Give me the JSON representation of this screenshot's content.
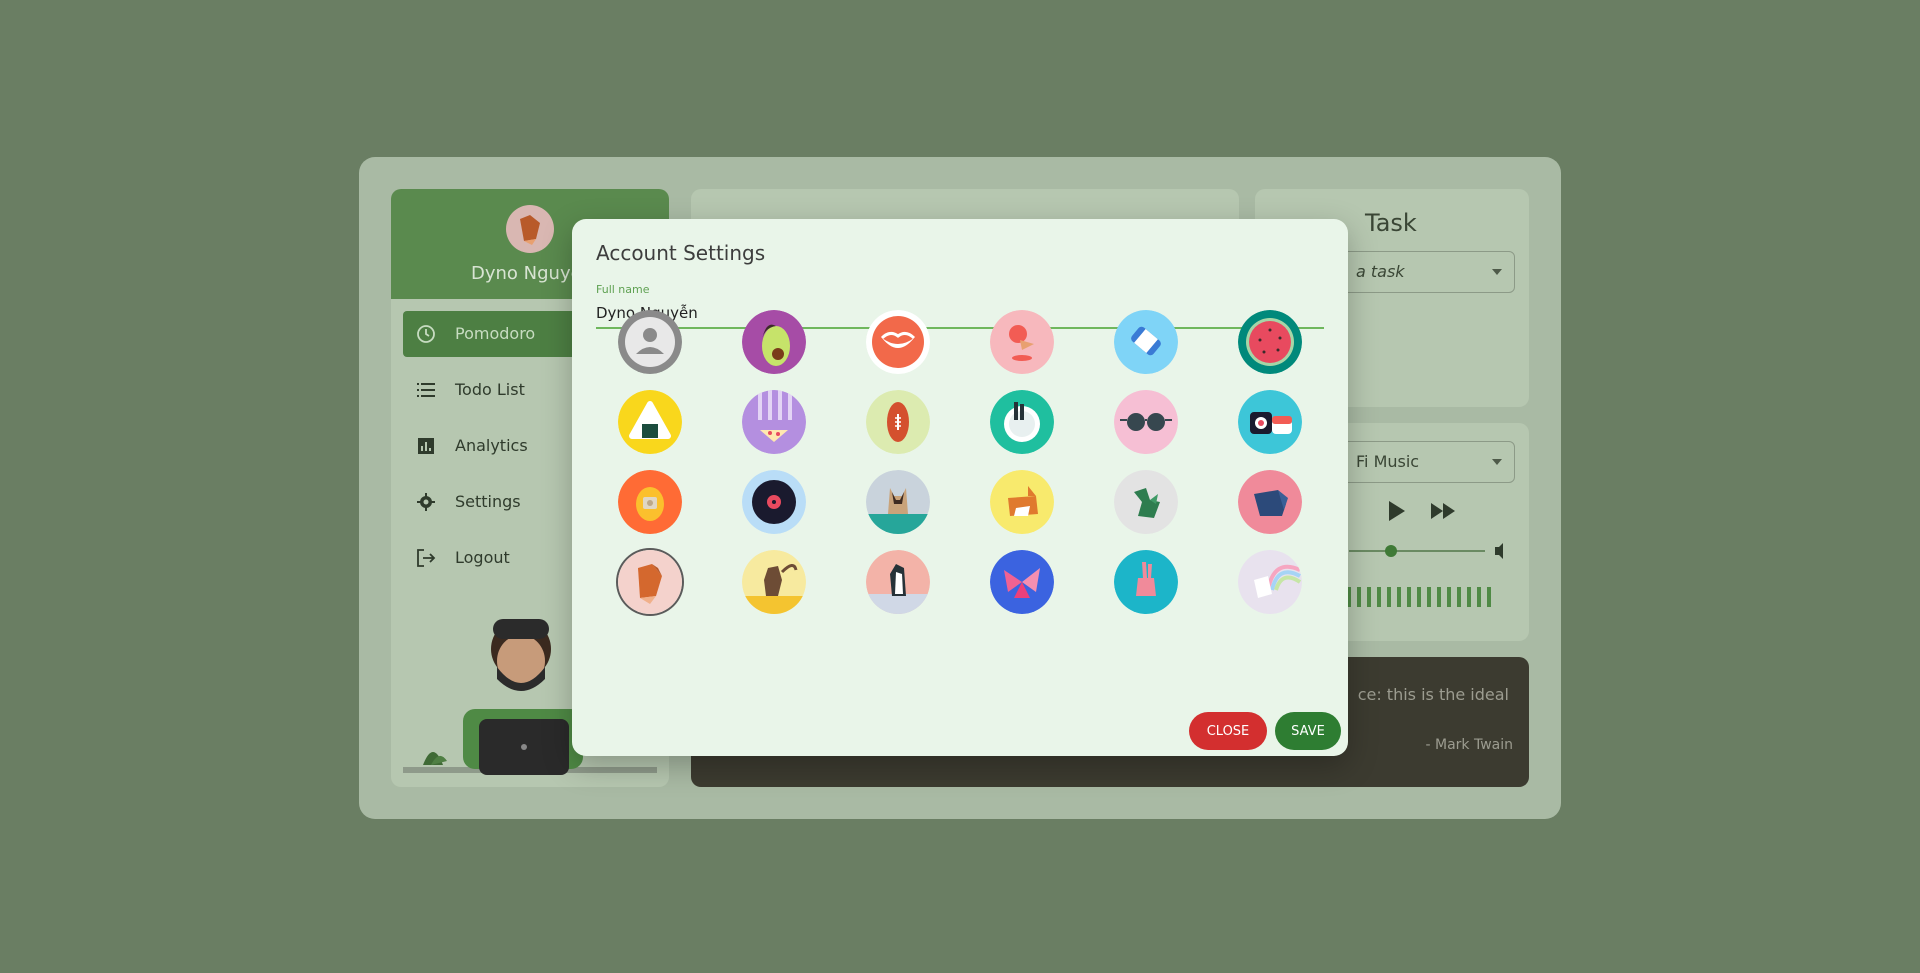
{
  "app": {
    "user_name": "Dyno Nguyễn",
    "nav": [
      {
        "label": "Pomodoro",
        "icon": "clock-icon",
        "active": true
      },
      {
        "label": "Todo List",
        "icon": "list-icon",
        "active": false
      },
      {
        "label": "Analytics",
        "icon": "chart-icon",
        "active": false
      },
      {
        "label": "Settings",
        "icon": "gear-icon",
        "active": false
      },
      {
        "label": "Logout",
        "icon": "logout-icon",
        "active": false
      }
    ],
    "task_panel": {
      "title": "Task",
      "select_text": "a task"
    },
    "music_panel": {
      "select_text": "Fi Music"
    },
    "quote": {
      "text": "ce: this is the ideal",
      "author": "- Mark Twain"
    }
  },
  "dialog": {
    "title": "Account Settings",
    "full_name_label": "Full name",
    "full_name_value": "Dyno Nguyễn",
    "avatars": [
      {
        "name": "default-user",
        "bg": "#8a8a8a",
        "selected": false
      },
      {
        "name": "avocado",
        "bg": "#a64ca6",
        "selected": false
      },
      {
        "name": "lips",
        "bg": "#ffffff",
        "selected": false
      },
      {
        "name": "ice-cream",
        "bg": "#f7b8bd",
        "selected": false
      },
      {
        "name": "plaster",
        "bg": "#7fd4f7",
        "selected": false
      },
      {
        "name": "watermelon",
        "bg": "#00897b",
        "selected": false
      },
      {
        "name": "onigiri",
        "bg": "#f9d71c",
        "selected": false
      },
      {
        "name": "pizza",
        "bg": "#b48fe0",
        "selected": false
      },
      {
        "name": "rugby-ball",
        "bg": "#dcebb0",
        "selected": false
      },
      {
        "name": "ramen",
        "bg": "#1fbf9f",
        "selected": false
      },
      {
        "name": "sunglasses",
        "bg": "#f6bfd4",
        "selected": false
      },
      {
        "name": "sushi",
        "bg": "#3dc6d8",
        "selected": false
      },
      {
        "name": "tamagotchi",
        "bg": "#ff6b35",
        "selected": false
      },
      {
        "name": "vinyl",
        "bg": "#b9ddf7",
        "selected": false
      },
      {
        "name": "cat",
        "bg": "#c9d3dc",
        "selected": false
      },
      {
        "name": "corgi",
        "bg": "#f8ea6d",
        "selected": false
      },
      {
        "name": "dinosaur",
        "bg": "#e3e3e3",
        "selected": false
      },
      {
        "name": "elephant",
        "bg": "#f08a9a",
        "selected": false
      },
      {
        "name": "fox",
        "bg": "#f4d2cc",
        "selected": true
      },
      {
        "name": "monkey",
        "bg": "#f7ea9f",
        "selected": false
      },
      {
        "name": "penguin",
        "bg": "#f3b3a8",
        "selected": false
      },
      {
        "name": "butterfly",
        "bg": "#3b63e0",
        "selected": false
      },
      {
        "name": "rabbit",
        "bg": "#1cb5c9",
        "selected": false
      },
      {
        "name": "unicorn",
        "bg": "#e8e2ee",
        "selected": false
      }
    ],
    "close_label": "CLOSE",
    "save_label": "SAVE"
  },
  "colors": {
    "backdrop": "#6a7e63",
    "primary": "#2e7d32",
    "danger": "#d32f2f",
    "dialog_bg": "#e9f5e9",
    "accent_underline": "#6fb75d"
  }
}
